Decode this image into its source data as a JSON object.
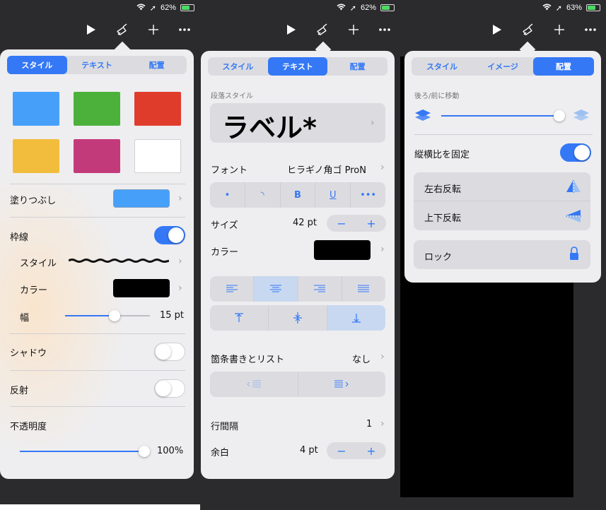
{
  "screens": [
    {
      "status": {
        "battery": "62%"
      }
    },
    {
      "status": {
        "battery": "62%"
      }
    },
    {
      "status": {
        "battery": "63%"
      }
    }
  ],
  "toolbar_icons": [
    "play-icon",
    "paintbrush-icon",
    "plus-icon",
    "more-icon"
  ],
  "panel1": {
    "tabs": [
      "スタイル",
      "テキスト",
      "配置"
    ],
    "active_tab": 0,
    "swatches": [
      "#46a0fa",
      "#4cb13b",
      "#e03c2c",
      "#f2bd3c",
      "#c33a7b",
      "#ffffff"
    ],
    "fill_label": "塗りつぶし",
    "fill_color": "#46a0fa",
    "border_label": "枠線",
    "border_on": true,
    "style_label": "スタイル",
    "color_label": "カラー",
    "border_color": "#000000",
    "width_label": "幅",
    "width_value": "15 pt",
    "width_slider": 0.58,
    "shadow_label": "シャドウ",
    "shadow_on": false,
    "reflection_label": "反射",
    "reflection_on": false,
    "opacity_label": "不透明度",
    "opacity_value": "100%",
    "opacity_slider": 1.0
  },
  "panel2": {
    "tabs": [
      "スタイル",
      "テキスト",
      "配置"
    ],
    "active_tab": 1,
    "para_style_label": "段落スタイル",
    "para_style_value": "ラベル*",
    "font_label": "フォント",
    "font_value": "ヒラギノ角ゴ ProN",
    "format_buttons": [
      "•",
      "◝",
      "B",
      "U",
      "•••"
    ],
    "size_label": "サイズ",
    "size_value": "42 pt",
    "color_label": "カラー",
    "text_color": "#000000",
    "bullets_label": "箇条書きとリスト",
    "bullets_value": "なし",
    "line_spacing_label": "行間隔",
    "line_spacing_value": "1",
    "margin_label": "余白",
    "margin_value": "4 pt",
    "stepper_minus": "−",
    "stepper_plus": "+"
  },
  "panel3": {
    "tabs": [
      "スタイル",
      "イメージ",
      "配置"
    ],
    "active_tab": 2,
    "move_label": "後ろ/前に移動",
    "move_slider": 0.98,
    "lock_aspect_label": "縦横比を固定",
    "lock_aspect_on": true,
    "flip_h_label": "左右反転",
    "flip_v_label": "上下反転",
    "lock_label": "ロック"
  }
}
